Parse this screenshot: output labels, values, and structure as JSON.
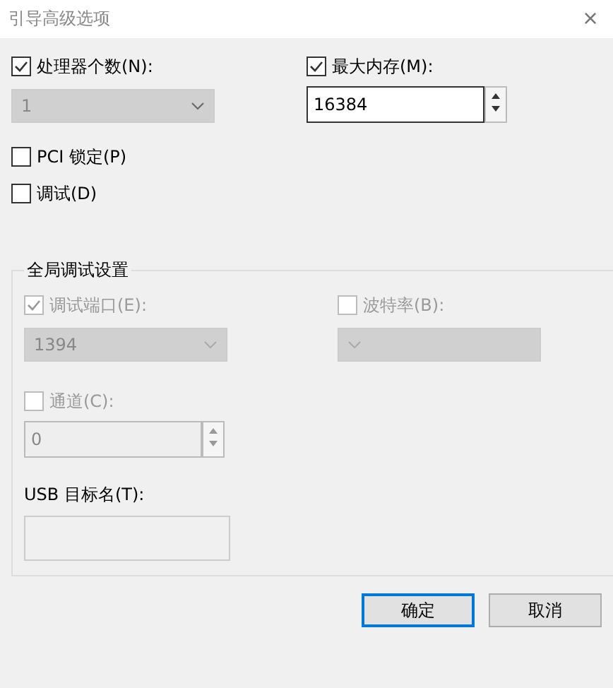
{
  "window": {
    "title": "引导高级选项",
    "close": "×"
  },
  "processors": {
    "label": "处理器个数(N):",
    "checked": true,
    "value": "1",
    "disabled": true
  },
  "max_memory": {
    "label": "最大内存(M):",
    "checked": true,
    "value": "16384"
  },
  "options": [
    {
      "label": "PCI 锁定(P)",
      "checked": false
    },
    {
      "label": "调试(D)",
      "checked": false
    }
  ],
  "debug_group": {
    "title": "全局调试设置",
    "debug_port": {
      "label": "调试端口(E):",
      "checked": true,
      "disabled": true,
      "value": "1394"
    },
    "baud_rate": {
      "label": "波特率(B):",
      "checked": false,
      "disabled": true
    },
    "channel": {
      "label": "通道(C):",
      "checked": false,
      "disabled": true,
      "value": "0"
    },
    "usb_target": {
      "label": "USB 目标名(T):"
    }
  },
  "buttons": [
    {
      "label": "确定"
    },
    {
      "label": "取消"
    }
  ]
}
